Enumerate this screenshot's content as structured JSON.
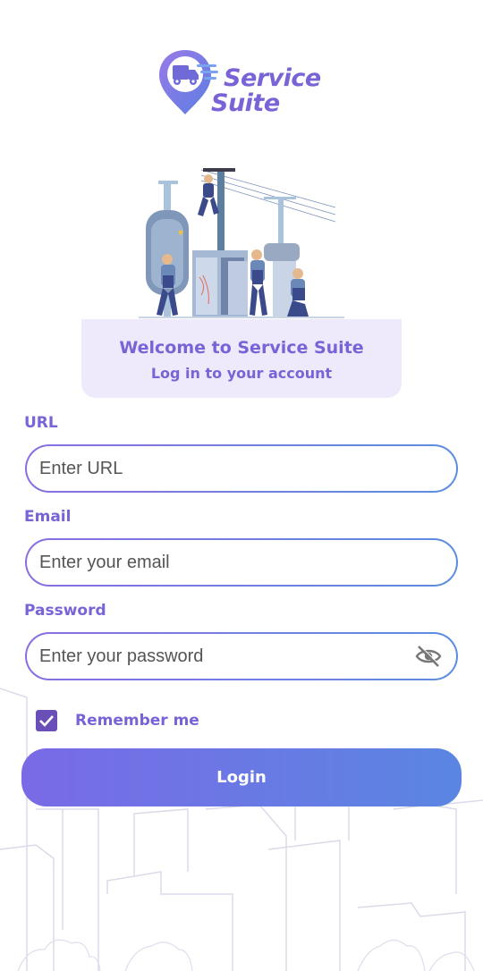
{
  "app": {
    "logo_line1": "Service",
    "logo_line2": "Suite",
    "icon_names": [
      "location-pin-truck-icon",
      "eye-off-icon",
      "checkmark-icon"
    ],
    "colors": {
      "accent": "#7a63d6",
      "card_bg": "#eeeafb",
      "button_start": "#7a6ae6",
      "button_end": "#5a86e2",
      "checkbox": "#6a4fb8"
    }
  },
  "welcome": {
    "title": "Welcome to Service Suite",
    "subtitle": "Log in to your account"
  },
  "form": {
    "url": {
      "label": "URL",
      "placeholder": "Enter URL",
      "value": ""
    },
    "email": {
      "label": "Email",
      "placeholder": "Enter your email",
      "value": ""
    },
    "password": {
      "label": "Password",
      "placeholder": "Enter your password",
      "value": ""
    },
    "remember": {
      "label": "Remember me",
      "checked": true
    },
    "login_label": "Login"
  }
}
